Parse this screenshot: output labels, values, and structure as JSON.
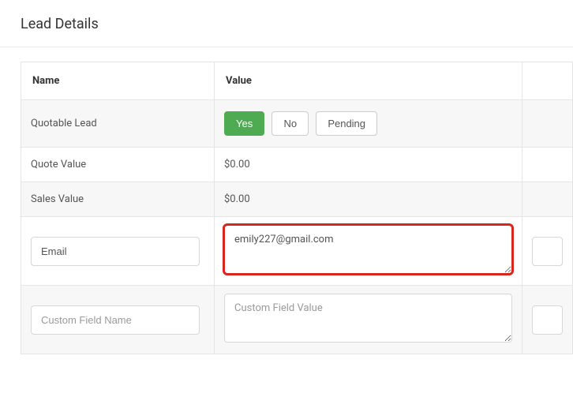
{
  "section_title": "Lead Details",
  "columns": {
    "name": "Name",
    "value": "Value"
  },
  "rows": {
    "quotable": {
      "label": "Quotable Lead",
      "options": {
        "yes": "Yes",
        "no": "No",
        "pending": "Pending"
      }
    },
    "quote_value": {
      "label": "Quote Value",
      "value": "$0.00"
    },
    "sales_value": {
      "label": "Sales Value",
      "value": "$0.00"
    },
    "email": {
      "label": "Email",
      "value": "emily227@gmail.com"
    },
    "custom": {
      "name_placeholder": "Custom Field Name",
      "value_placeholder": "Custom Field Value"
    }
  }
}
